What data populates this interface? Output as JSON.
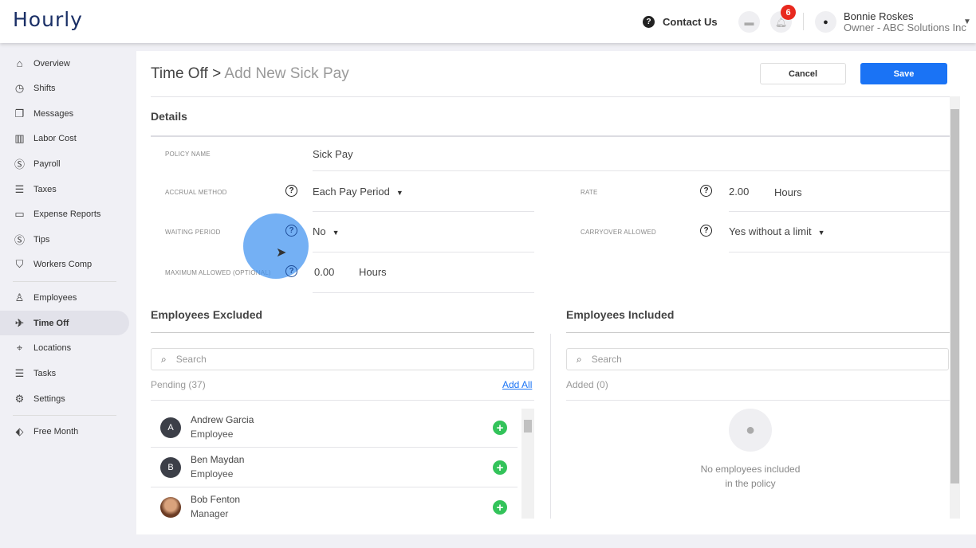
{
  "header": {
    "logo": "Hourly",
    "contact": "Contact Us",
    "notifications": "6",
    "user_name": "Bonnie Roskes",
    "user_role": "Owner - ABC Solutions Inc"
  },
  "sidebar": {
    "items": [
      {
        "label": "Overview",
        "icon": "home-icon"
      },
      {
        "label": "Shifts",
        "icon": "clock-icon"
      },
      {
        "label": "Messages",
        "icon": "chat-icon"
      },
      {
        "label": "Labor Cost",
        "icon": "bar-chart-icon"
      },
      {
        "label": "Payroll",
        "icon": "dollar-icon"
      },
      {
        "label": "Taxes",
        "icon": "document-icon"
      },
      {
        "label": "Expense Reports",
        "icon": "folder-icon"
      },
      {
        "label": "Tips",
        "icon": "dollar-icon"
      },
      {
        "label": "Workers Comp",
        "icon": "shield-icon"
      },
      {
        "label": "Employees",
        "icon": "person-icon"
      },
      {
        "label": "Time Off",
        "icon": "plane-icon"
      },
      {
        "label": "Locations",
        "icon": "pin-icon"
      },
      {
        "label": "Tasks",
        "icon": "list-icon"
      },
      {
        "label": "Settings",
        "icon": "gear-icon"
      },
      {
        "label": "Free Month",
        "icon": "tag-icon"
      }
    ]
  },
  "page": {
    "crumb": "Time Off >",
    "title": " Add New Sick Pay",
    "cancel": "Cancel",
    "save": "Save",
    "details": "Details"
  },
  "form": {
    "policy_name_label": "POLICY NAME",
    "policy_name": "Sick Pay",
    "accrual_label": "ACCRUAL METHOD",
    "accrual": "Each Pay Period",
    "rate_label": "RATE",
    "rate": "2.00",
    "rate_unit": "Hours",
    "waiting_label": "WAITING PERIOD",
    "waiting": "No",
    "carryover_label": "CARRYOVER ALLOWED",
    "carryover": "Yes without a limit",
    "max_label": "MAXIMUM ALLOWED (OPTIONAL)",
    "max": "0.00",
    "max_unit": "Hours"
  },
  "excluded": {
    "title": "Employees Excluded",
    "search_placeholder": "Search",
    "pending": "Pending (37)",
    "add_all": "Add All",
    "employees": [
      {
        "initial": "A",
        "name": "Andrew Garcia",
        "role": "Employee"
      },
      {
        "initial": "B",
        "name": "Ben Maydan",
        "role": "Employee"
      },
      {
        "initial": "",
        "name": "Bob Fenton",
        "role": "Manager"
      }
    ]
  },
  "included": {
    "title": "Employees Included",
    "search_placeholder": "Search",
    "added": "Added (0)",
    "empty_line1": "No employees included",
    "empty_line2": "in the policy"
  },
  "colors": {
    "accent": "#1a73f5",
    "badge": "#e8281e",
    "add": "#33c35a"
  }
}
